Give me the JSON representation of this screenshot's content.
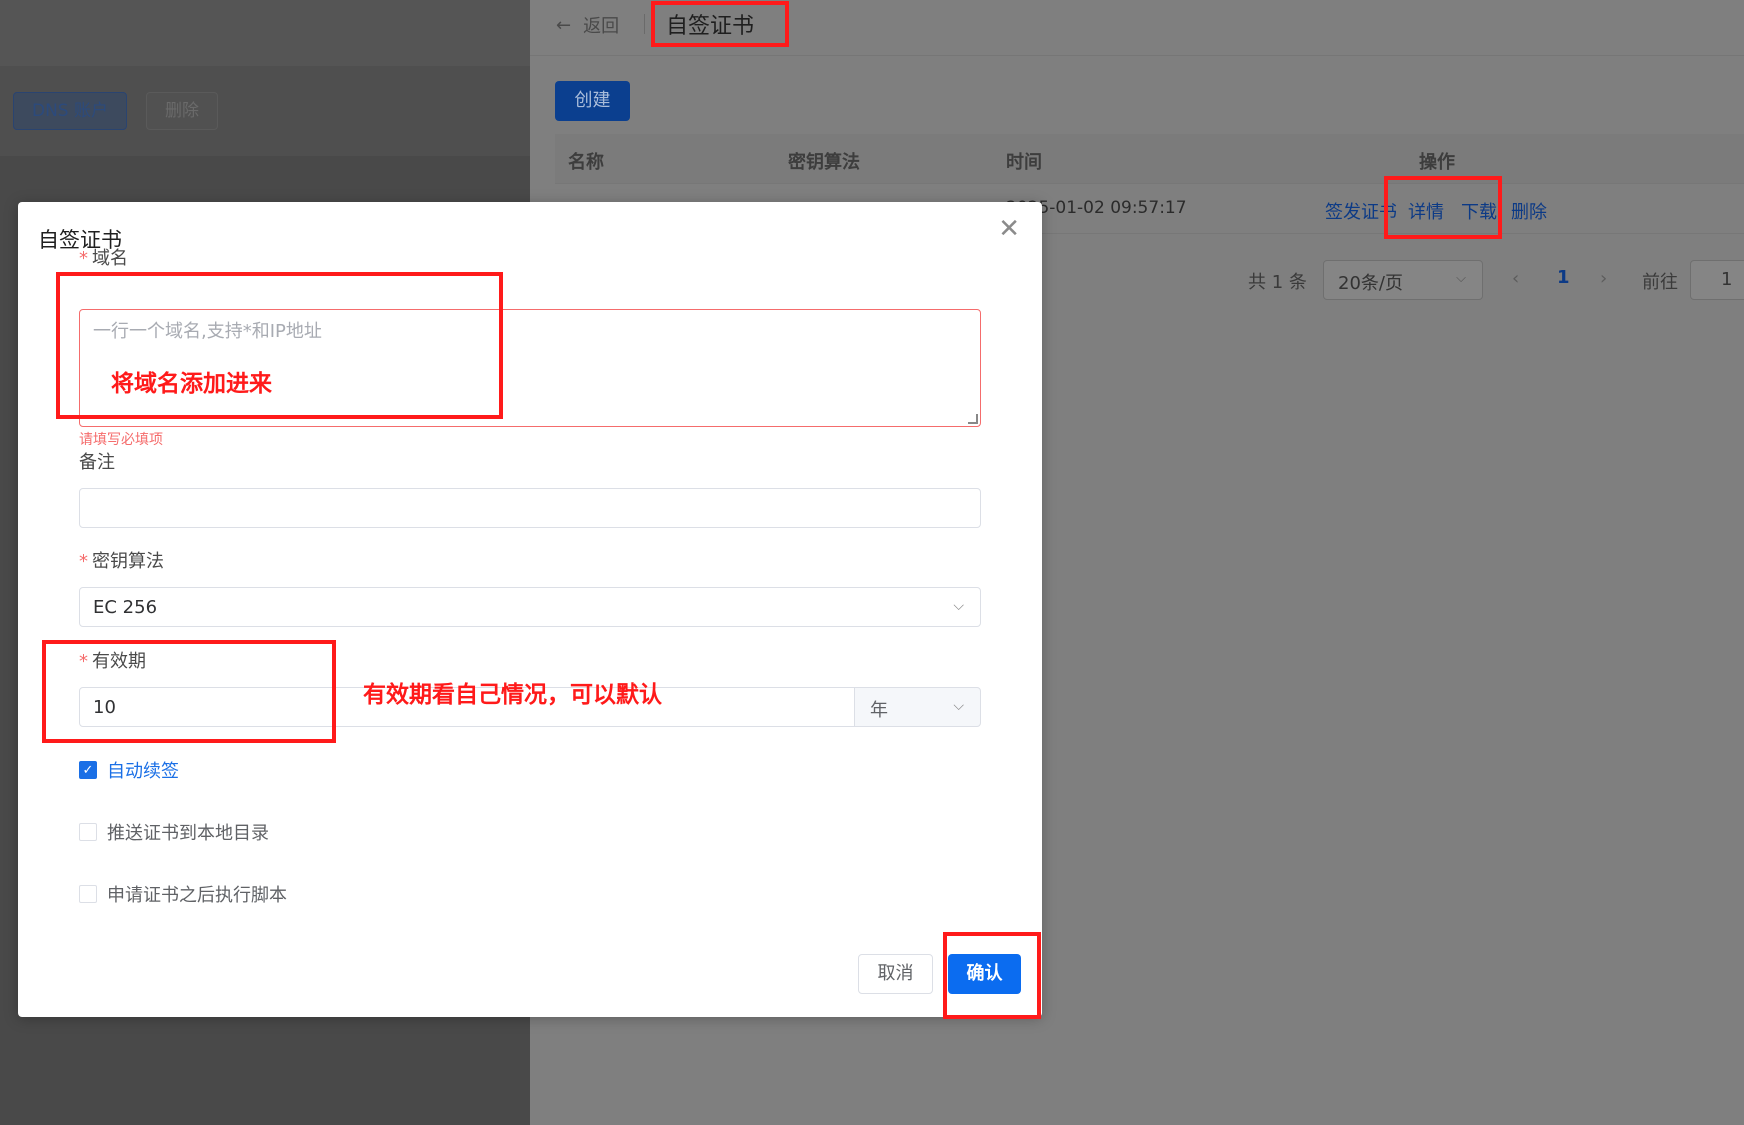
{
  "bg_page": {
    "dns_button": "DNS 账户",
    "delete_button": "删除"
  },
  "drawer": {
    "back_label": "返回",
    "title": "自签证书",
    "create_button": "创建",
    "table": {
      "columns": [
        "名称",
        "密钥算法",
        "时间",
        "操作"
      ],
      "rows": [
        {
          "name": "",
          "algo": "",
          "time": "2025-01-02 09:57:17",
          "actions": [
            "签发证书",
            "详情",
            "下载",
            "删除"
          ]
        }
      ]
    },
    "pagination": {
      "total": "共 1 条",
      "page_size": "20条/页",
      "current_page": "1",
      "goto_label": "前往",
      "goto_value": "1"
    }
  },
  "modal": {
    "title": "自签证书",
    "domain": {
      "label": "域名",
      "placeholder": "一行一个域名,支持*和IP地址",
      "error": "请填写必填项"
    },
    "remark": {
      "label": "备注",
      "value": ""
    },
    "algorithm": {
      "label": "密钥算法",
      "value": "EC 256"
    },
    "validity": {
      "label": "有效期",
      "value": "10",
      "unit": "年"
    },
    "checkboxes": [
      {
        "label": "自动续签",
        "checked": true
      },
      {
        "label": "推送证书到本地目录",
        "checked": false
      },
      {
        "label": "申请证书之后执行脚本",
        "checked": false
      }
    ],
    "cancel_button": "取消",
    "confirm_button": "确认"
  },
  "annotations": {
    "domain_note": "将域名添加进来",
    "validity_note": "有效期看自己情况，可以默认"
  },
  "colors": {
    "primary": "#0b6cf0",
    "annotation_red": "#ff1a1a",
    "error_red": "#f56c6c"
  }
}
